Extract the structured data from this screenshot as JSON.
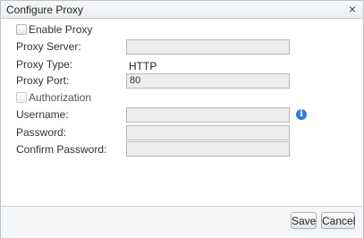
{
  "dialog": {
    "title": "Configure Proxy",
    "close_glyph": "×"
  },
  "enable_proxy": {
    "label": "Enable Proxy",
    "checked": false
  },
  "proxy_server": {
    "label": "Proxy Server:",
    "value": ""
  },
  "proxy_type": {
    "label": "Proxy Type:",
    "value": "HTTP"
  },
  "proxy_port": {
    "label": "Proxy Port:",
    "value": "80"
  },
  "authorization": {
    "label": "Authorization",
    "checked": false,
    "disabled": true
  },
  "username": {
    "label": "Username:",
    "value": "",
    "info_icon": "info-icon"
  },
  "password": {
    "label": "Password:",
    "value": ""
  },
  "confirm_password": {
    "label": "Confirm Password:",
    "value": ""
  },
  "buttons": {
    "save": "Save",
    "cancel": "Cancel"
  },
  "colors": {
    "info_icon": "#2f7fd8",
    "field_bg": "#ededed"
  }
}
